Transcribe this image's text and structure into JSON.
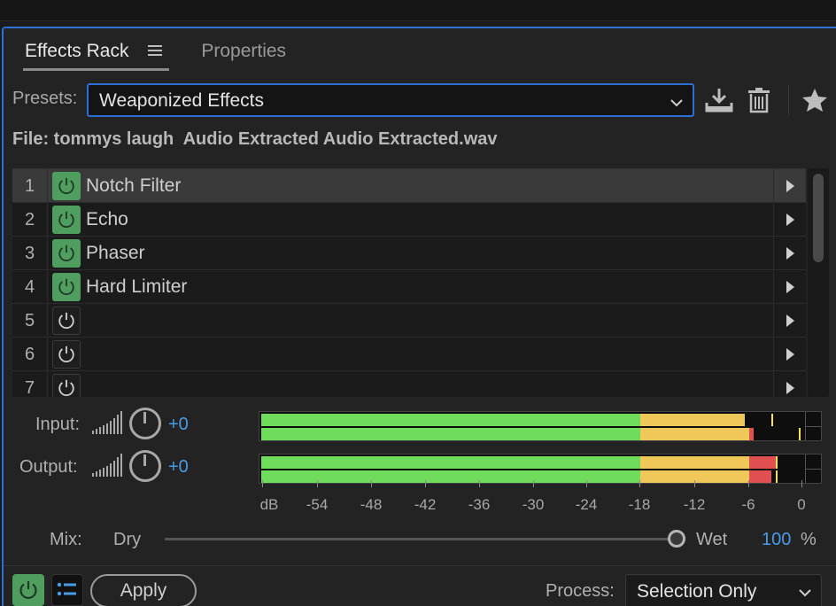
{
  "tabs": [
    {
      "label": "Effects Rack",
      "active": true
    },
    {
      "label": "Properties",
      "active": false
    }
  ],
  "presets": {
    "label": "Presets:",
    "value": "Weaponized Effects"
  },
  "file": {
    "label": "File: tommys laugh  Audio Extracted Audio Extracted.wav"
  },
  "rack": {
    "slots": [
      {
        "num": "1",
        "name": "Notch Filter",
        "on": true,
        "selected": true
      },
      {
        "num": "2",
        "name": "Echo",
        "on": true,
        "selected": false
      },
      {
        "num": "3",
        "name": "Phaser",
        "on": true,
        "selected": false
      },
      {
        "num": "4",
        "name": "Hard Limiter",
        "on": true,
        "selected": false
      },
      {
        "num": "5",
        "name": "",
        "on": false,
        "selected": false
      },
      {
        "num": "6",
        "name": "",
        "on": false,
        "selected": false
      },
      {
        "num": "7",
        "name": "",
        "on": false,
        "selected": false
      }
    ]
  },
  "input": {
    "label": "Input:",
    "value": "+0",
    "levels_db": [
      -6.5,
      -5.5
    ],
    "peaks_db": [
      -3.5,
      -0.5
    ]
  },
  "output": {
    "label": "Output:",
    "value": "+0",
    "levels_db": [
      -3,
      -3.5
    ],
    "peaks_db": [
      -3,
      -3
    ]
  },
  "scale": {
    "ticks": [
      "dB",
      "-54",
      "-48",
      "-42",
      "-36",
      "-30",
      "-24",
      "-18",
      "-12",
      "-6",
      "0"
    ]
  },
  "mix": {
    "label": "Mix:",
    "dry_label": "Dry",
    "wet_label": "Wet",
    "value": "100",
    "unit": "%"
  },
  "bottom": {
    "apply_label": "Apply",
    "process_label": "Process:",
    "process_value": "Selection Only"
  },
  "colors": {
    "accent": "#2d6fd6",
    "power_on": "#4f9e5f",
    "meter_green": "#6fdc5b",
    "meter_yellow": "#f0c85a",
    "meter_red": "#e05050",
    "value_blue": "#4a9be8"
  }
}
